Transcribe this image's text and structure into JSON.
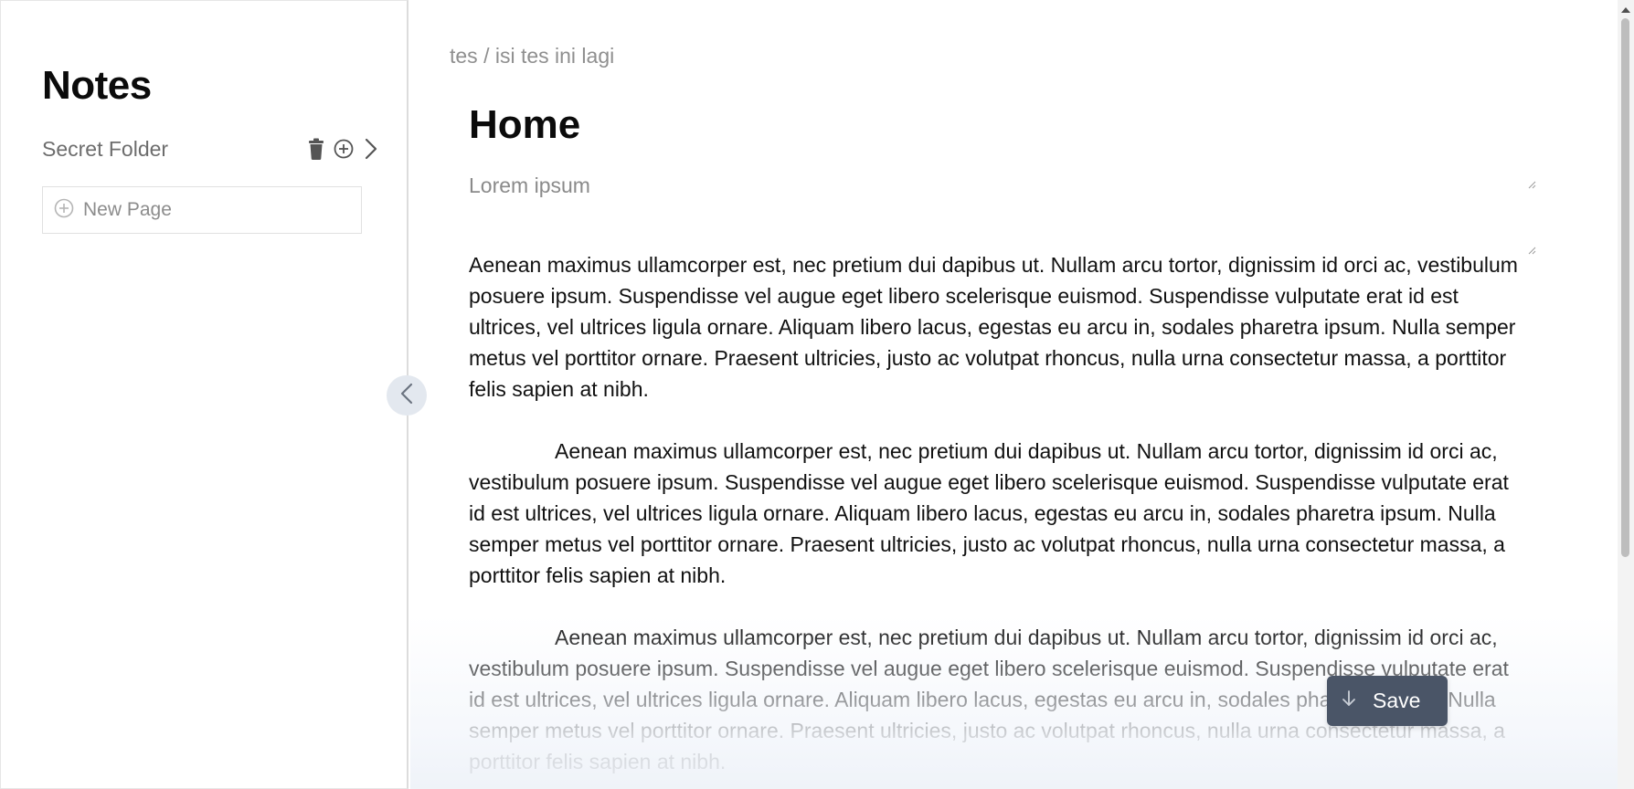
{
  "sidebar": {
    "title": "Notes",
    "folder": {
      "name": "Secret Folder",
      "actions": [
        "trash-icon",
        "plus-circle-icon",
        "chevron-right-icon"
      ]
    },
    "new_page_label": "New Page"
  },
  "breadcrumb": "tes / isi tes ini lagi",
  "page": {
    "title": "Home",
    "subtitle": "Lorem ipsum",
    "paragraphs": [
      "Aenean maximus ullamcorper est, nec pretium dui dapibus ut. Nullam arcu tortor, dignissim id orci ac, vestibulum posuere ipsum. Suspendisse vel augue eget libero scelerisque euismod. Suspendisse vulputate erat id est ultrices, vel ultrices ligula ornare. Aliquam libero lacus, egestas eu arcu in, sodales pharetra ipsum. Nulla semper metus vel porttitor ornare. Praesent ultricies, justo ac volutpat rhoncus, nulla urna consectetur massa, a porttitor felis sapien at nibh.",
      "Aenean maximus ullamcorper est, nec pretium dui dapibus ut. Nullam arcu tortor, dignissim id orci ac, vestibulum posuere ipsum. Suspendisse vel augue eget libero scelerisque euismod. Suspendisse vulputate erat id est ultrices, vel ultrices ligula ornare. Aliquam libero lacus, egestas eu arcu in, sodales pharetra ipsum. Nulla semper metus vel porttitor ornare. Praesent ultricies, justo ac volutpat rhoncus, nulla urna consectetur massa, a porttitor felis sapien at nibh.",
      "Aenean maximus ullamcorper est, nec pretium dui dapibus ut. Nullam arcu tortor, dignissim id orci ac, vestibulum posuere ipsum. Suspendisse vel augue eget libero scelerisque euismod. Suspendisse vulputate erat id est ultrices, vel ultrices ligula ornare. Aliquam libero lacus, egestas eu arcu in, sodales pharetra ipsum. Nulla semper metus vel porttitor ornare. Praesent ultricies, justo ac volutpat rhoncus, nulla urna consectetur massa, a porttitor felis sapien at nibh."
    ]
  },
  "save_button": {
    "label": "Save",
    "icon": "arrow-down-icon"
  },
  "colors": {
    "save_bg": "#4a5567",
    "collapse_bg": "#e3e8ef",
    "muted_text": "#8f8f8f"
  }
}
